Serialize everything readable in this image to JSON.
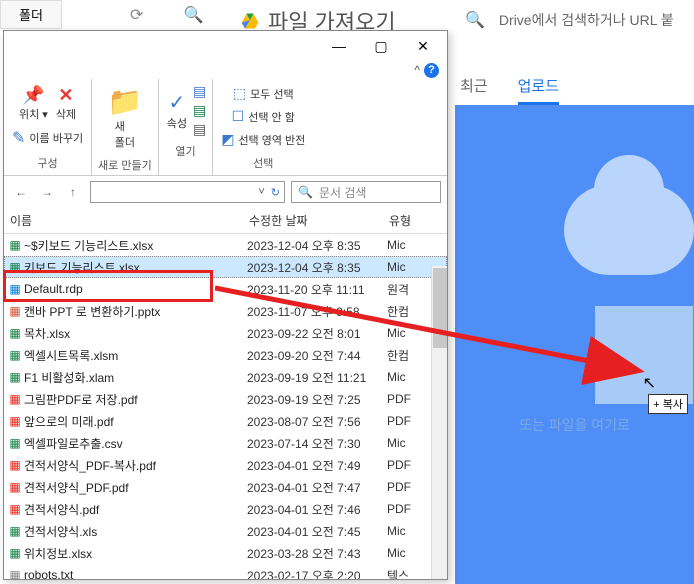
{
  "background": {
    "folder_tab": "폴더",
    "drive_title": "파일 가져오기",
    "search_placeholder": "Drive에서 검색하거나 URL 붙",
    "tabs": {
      "recent": "최근",
      "upload": "업로드"
    },
    "drop_text": "또는 파일을 여기로",
    "drop_badge": "+ 복사"
  },
  "explorer": {
    "ribbon": {
      "group1": {
        "move_to": "위치 ▾",
        "delete": "삭제",
        "rename": "이름 바꾸기",
        "label": "구성"
      },
      "group2": {
        "new_folder": "새\n폴더",
        "label": "새로 만들기"
      },
      "group3": {
        "properties": "속성",
        "label": "열기"
      },
      "group4": {
        "select_all": "모두 선택",
        "select_none": "선택 안 함",
        "invert": "선택 영역 반전",
        "label": "선택"
      }
    },
    "search_placeholder": "문서 검색",
    "addr_refresh": "↻",
    "columns": {
      "name": "이름",
      "date": "수정한 날짜",
      "type": "유형"
    },
    "files": [
      {
        "icon": "xlsx",
        "name": "~$키보드 기능리스트.xlsx",
        "date": "2023-12-04 오후 8:35",
        "type": "Mic"
      },
      {
        "icon": "xlsx",
        "name": "키보드 기능리스트.xlsx",
        "date": "2023-12-04 오후 8:35",
        "type": "Mic",
        "selected": true
      },
      {
        "icon": "rdp",
        "name": "Default.rdp",
        "date": "2023-11-20 오후 11:11",
        "type": "원격"
      },
      {
        "icon": "pptx",
        "name": "캔바 PPT 로 변환하기.pptx",
        "date": "2023-11-07 오후 9:58",
        "type": "한컴"
      },
      {
        "icon": "xlsx",
        "name": "목차.xlsx",
        "date": "2023-09-22 오전 8:01",
        "type": "Mic"
      },
      {
        "icon": "xlsm",
        "name": "엑셀시트목록.xlsm",
        "date": "2023-09-20 오전 7:44",
        "type": "한컴"
      },
      {
        "icon": "xlam",
        "name": "F1 비활성화.xlam",
        "date": "2023-09-19 오전 11:21",
        "type": "Mic"
      },
      {
        "icon": "pdf",
        "name": "그림판PDF로 저장.pdf",
        "date": "2023-09-19 오전 7:25",
        "type": "PDF"
      },
      {
        "icon": "pdf",
        "name": "앞으로의 미래.pdf",
        "date": "2023-08-07 오전 7:56",
        "type": "PDF"
      },
      {
        "icon": "csv",
        "name": "엑셀파일로추출.csv",
        "date": "2023-07-14 오전 7:30",
        "type": "Mic"
      },
      {
        "icon": "pdf",
        "name": "견적서양식_PDF-복사.pdf",
        "date": "2023-04-01 오전 7:49",
        "type": "PDF"
      },
      {
        "icon": "pdf",
        "name": "견적서양식_PDF.pdf",
        "date": "2023-04-01 오전 7:47",
        "type": "PDF"
      },
      {
        "icon": "pdf",
        "name": "견적서양식.pdf",
        "date": "2023-04-01 오전 7:46",
        "type": "PDF"
      },
      {
        "icon": "xls",
        "name": "견적서양식.xls",
        "date": "2023-04-01 오전 7:45",
        "type": "Mic"
      },
      {
        "icon": "xlsx",
        "name": "위치정보.xlsx",
        "date": "2023-03-28 오전 7:43",
        "type": "Mic"
      },
      {
        "icon": "txt",
        "name": "robots.txt",
        "date": "2023-02-17 오후 2:20",
        "type": "텍스"
      }
    ]
  }
}
